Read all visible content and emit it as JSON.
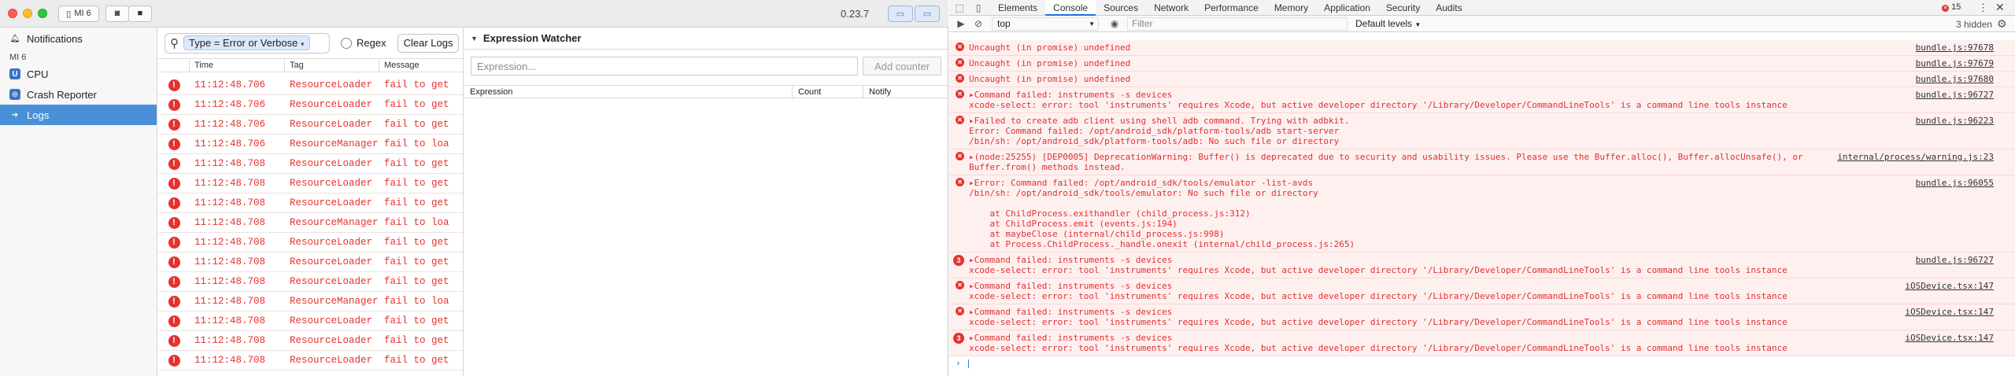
{
  "app": {
    "device_button_label": "MI 6",
    "version": "0.23.7"
  },
  "sidebar": {
    "notifications_label": "Notifications",
    "section_label": "MI 6",
    "items": [
      {
        "label": "CPU",
        "icon": "cpu-icon"
      },
      {
        "label": "Crash Reporter",
        "icon": "crash-reporter-icon"
      },
      {
        "label": "Logs",
        "icon": "logs-icon",
        "active": true
      }
    ]
  },
  "logs": {
    "filter_chip": "Type = Error or Verbose",
    "regex_label": "Regex",
    "clear_label": "Clear Logs",
    "columns": [
      "Time",
      "Tag",
      "Message"
    ],
    "rows": [
      {
        "time": "11:12:48.706",
        "tag": "ResourceLoader",
        "message": "fail to get"
      },
      {
        "time": "11:12:48.706",
        "tag": "ResourceLoader",
        "message": "fail to get"
      },
      {
        "time": "11:12:48.706",
        "tag": "ResourceLoader",
        "message": "fail to get"
      },
      {
        "time": "11:12:48.706",
        "tag": "ResourceManager",
        "message": "fail to loa"
      },
      {
        "time": "11:12:48.708",
        "tag": "ResourceLoader",
        "message": "fail to get"
      },
      {
        "time": "11:12:48.708",
        "tag": "ResourceLoader",
        "message": "fail to get"
      },
      {
        "time": "11:12:48.708",
        "tag": "ResourceLoader",
        "message": "fail to get"
      },
      {
        "time": "11:12:48.708",
        "tag": "ResourceManager",
        "message": "fail to loa"
      },
      {
        "time": "11:12:48.708",
        "tag": "ResourceLoader",
        "message": "fail to get"
      },
      {
        "time": "11:12:48.708",
        "tag": "ResourceLoader",
        "message": "fail to get"
      },
      {
        "time": "11:12:48.708",
        "tag": "ResourceLoader",
        "message": "fail to get"
      },
      {
        "time": "11:12:48.708",
        "tag": "ResourceManager",
        "message": "fail to loa"
      },
      {
        "time": "11:12:48.708",
        "tag": "ResourceLoader",
        "message": "fail to get"
      },
      {
        "time": "11:12:48.708",
        "tag": "ResourceLoader",
        "message": "fail to get"
      },
      {
        "time": "11:12:48.708",
        "tag": "ResourceLoader",
        "message": "fail to get"
      }
    ]
  },
  "watcher": {
    "title": "Expression Watcher",
    "input_placeholder": "Expression...",
    "add_label": "Add counter",
    "columns": [
      "Expression",
      "Count",
      "Notify"
    ]
  },
  "devtools": {
    "tabs": [
      "Elements",
      "Console",
      "Sources",
      "Network",
      "Performance",
      "Memory",
      "Application",
      "Security",
      "Audits"
    ],
    "active_tab": "Console",
    "error_count": "15",
    "context": "top",
    "filter_placeholder": "Filter",
    "levels": "Default levels",
    "hidden": "3 hidden",
    "messages": [
      {
        "text": "Uncaught (in promise) undefined",
        "source": "bundle.js:97678"
      },
      {
        "text": "Uncaught (in promise) undefined",
        "source": "bundle.js:97679"
      },
      {
        "text": "Uncaught (in promise) undefined",
        "source": "bundle.js:97680"
      },
      {
        "text": "▸Command failed: instruments -s devices\nxcode-select: error: tool 'instruments' requires Xcode, but active developer directory '/Library/Developer/CommandLineTools' is a command line tools instance",
        "source": "bundle.js:96727"
      },
      {
        "text": "▸Failed to create adb client using shell adb command. Trying with adbkit.\nError: Command failed: /opt/android_sdk/platform-tools/adb start-server\n/bin/sh: /opt/android_sdk/platform-tools/adb: No such file or directory",
        "source": "bundle.js:96223"
      },
      {
        "text": "▸(node:25255) [DEP0005] DeprecationWarning: Buffer() is deprecated due to security and usability issues. Please use the Buffer.alloc(), Buffer.allocUnsafe(), or\nBuffer.from() methods instead.",
        "source": "internal/process/warning.js:23"
      },
      {
        "text": "▸Error: Command failed: /opt/android_sdk/tools/emulator -list-avds\n/bin/sh: /opt/android_sdk/tools/emulator: No such file or directory\n\n    at ChildProcess.exithandler (child_process.js:312)\n    at ChildProcess.emit (events.js:194)\n    at maybeClose (internal/child_process.js:998)\n    at Process.ChildProcess._handle.onexit (internal/child_process.js:265)",
        "source": "bundle.js:96055"
      },
      {
        "text": "▸Command failed: instruments -s devices\nxcode-select: error: tool 'instruments' requires Xcode, but active developer directory '/Library/Developer/CommandLineTools' is a command line tools instance",
        "source": "bundle.js:96727",
        "count": "3"
      },
      {
        "text": "▸Command failed: instruments -s devices\nxcode-select: error: tool 'instruments' requires Xcode, but active developer directory '/Library/Developer/CommandLineTools' is a command line tools instance",
        "source": "iOSDevice.tsx:147"
      },
      {
        "text": "▸Command failed: instruments -s devices\nxcode-select: error: tool 'instruments' requires Xcode, but active developer directory '/Library/Developer/CommandLineTools' is a command line tools instance",
        "source": "iOSDevice.tsx:147"
      },
      {
        "text": "▸Command failed: instruments -s devices\nxcode-select: error: tool 'instruments' requires Xcode, but active developer directory '/Library/Developer/CommandLineTools' is a command line tools instance",
        "source": "iOSDevice.tsx:147",
        "count": "3"
      }
    ]
  },
  "colors": {
    "accent": "#4a90d9",
    "error": "#e5322d",
    "close": "#fd5f57",
    "minimize": "#febc2e",
    "zoom": "#28c840"
  }
}
